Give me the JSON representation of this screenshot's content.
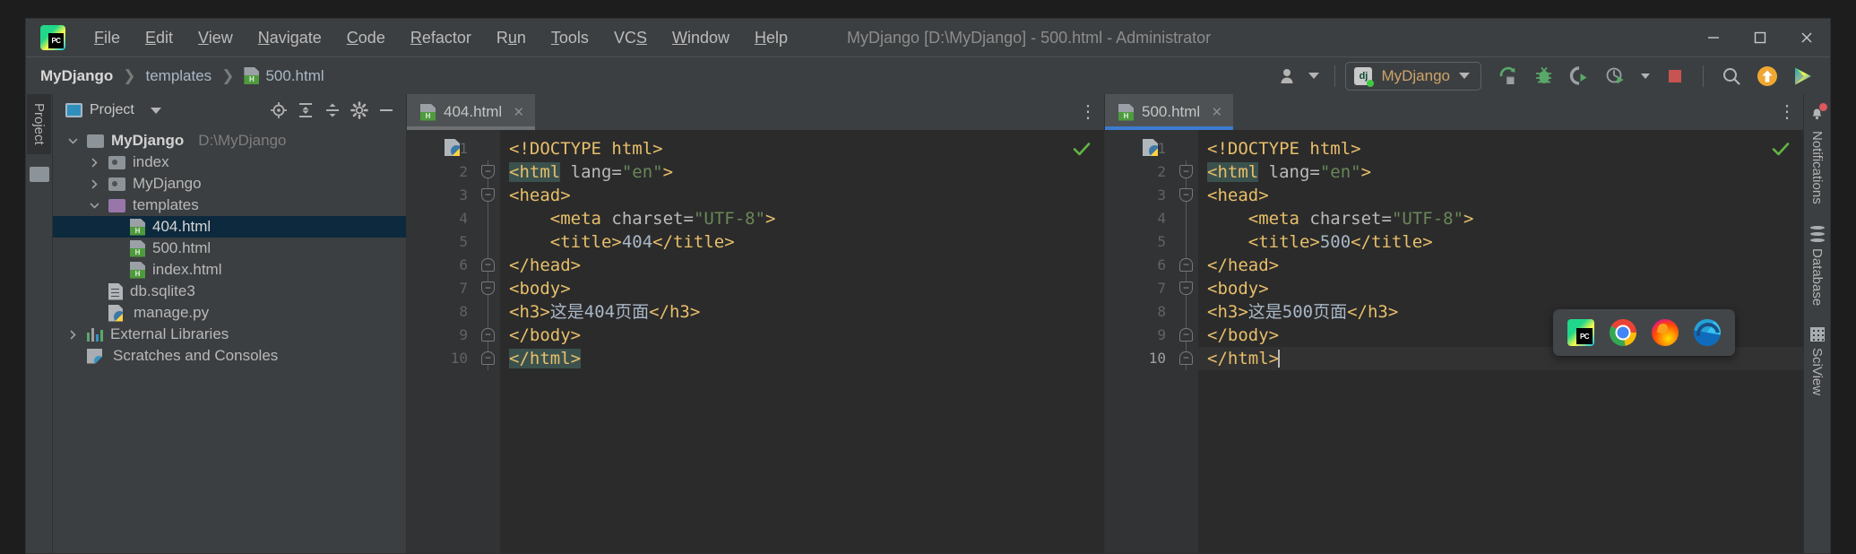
{
  "window": {
    "title": "MyDjango [D:\\MyDjango] - 500.html - Administrator",
    "app_icon": "pycharm-logo-icon",
    "minimize_label": "minimize-icon",
    "maximize_label": "maximize-icon",
    "close_label": "close-icon"
  },
  "menu": [
    {
      "label": "File",
      "mnemonic": "F"
    },
    {
      "label": "Edit",
      "mnemonic": "E"
    },
    {
      "label": "View",
      "mnemonic": "V"
    },
    {
      "label": "Navigate",
      "mnemonic": "N"
    },
    {
      "label": "Code",
      "mnemonic": "C"
    },
    {
      "label": "Refactor",
      "mnemonic": "R"
    },
    {
      "label": "Run",
      "mnemonic": "u"
    },
    {
      "label": "Tools",
      "mnemonic": "T"
    },
    {
      "label": "VCS",
      "mnemonic": "S"
    },
    {
      "label": "Window",
      "mnemonic": "W"
    },
    {
      "label": "Help",
      "mnemonic": "H"
    }
  ],
  "breadcrumb": [
    {
      "label": "MyDjango",
      "icon": ""
    },
    {
      "label": "templates",
      "icon": ""
    },
    {
      "label": "500.html",
      "icon": "html-file-icon"
    }
  ],
  "toolbar": {
    "user_icon": "user-account-icon",
    "run_config": {
      "name": "MyDjango",
      "icon": "django-icon"
    },
    "run_label": "run-icon",
    "debug_label": "debug-icon",
    "coverage_label": "coverage-icon",
    "profile_label": "profile-icon",
    "stop_label": "stop-icon",
    "search_label": "search-everywhere-icon",
    "update_label": "update-project-icon",
    "datalore_label": "datalore-icon"
  },
  "left_rail": {
    "tab": "Project"
  },
  "project_panel": {
    "title": "Project",
    "actions": [
      "locate-icon",
      "expand-all-icon",
      "collapse-all-icon",
      "settings-icon",
      "hide-icon"
    ],
    "tree": [
      {
        "label": "MyDjango",
        "sub": "D:\\MyDjango",
        "icon": "folder-root-icon",
        "depth": 0,
        "twisty": "expanded",
        "bold": true,
        "selected": false
      },
      {
        "label": "index",
        "sub": "",
        "icon": "folder-source-icon",
        "depth": 1,
        "twisty": "collapsed",
        "bold": false,
        "selected": false
      },
      {
        "label": "MyDjango",
        "sub": "",
        "icon": "folder-source-icon",
        "depth": 1,
        "twisty": "collapsed",
        "bold": false,
        "selected": false
      },
      {
        "label": "templates",
        "sub": "",
        "icon": "folder-templates-icon",
        "depth": 1,
        "twisty": "expanded",
        "bold": false,
        "selected": false
      },
      {
        "label": "404.html",
        "sub": "",
        "icon": "html-file-icon",
        "depth": 2,
        "twisty": "none",
        "bold": false,
        "selected": true
      },
      {
        "label": "500.html",
        "sub": "",
        "icon": "html-file-icon",
        "depth": 2,
        "twisty": "none",
        "bold": false,
        "selected": false
      },
      {
        "label": "index.html",
        "sub": "",
        "icon": "html-file-icon",
        "depth": 2,
        "twisty": "none",
        "bold": false,
        "selected": false
      },
      {
        "label": "db.sqlite3",
        "sub": "",
        "icon": "sqlite-file-icon",
        "depth": 1,
        "twisty": "none",
        "bold": false,
        "selected": false
      },
      {
        "label": "manage.py",
        "sub": "",
        "icon": "python-file-icon",
        "depth": 1,
        "twisty": "none",
        "bold": false,
        "selected": false
      },
      {
        "label": "External Libraries",
        "sub": "",
        "icon": "libraries-icon",
        "depth": 0,
        "twisty": "collapsed",
        "bold": false,
        "selected": false
      },
      {
        "label": "Scratches and Consoles",
        "sub": "",
        "icon": "scratches-icon",
        "depth": 0,
        "twisty": "none",
        "bold": false,
        "selected": false
      }
    ]
  },
  "editors": [
    {
      "tab": {
        "label": "404.html",
        "icon": "html-file-icon",
        "active": false,
        "close": "×"
      },
      "more_label": "⋮",
      "inspection_status": "✔",
      "lines": [
        {
          "no": "1",
          "fold": "none",
          "current": false,
          "segments": [
            {
              "t": "        ",
              "c": "txt"
            },
            {
              "t": "<!DOCTYPE html>",
              "c": "tag"
            }
          ]
        },
        {
          "no": "2",
          "fold": "down",
          "current": false,
          "segments": [
            {
              "t": "",
              "c": "txt"
            },
            {
              "t": "<html",
              "c": "tag hl"
            },
            {
              "t": " ",
              "c": "txt"
            },
            {
              "t": "lang=",
              "c": "attr"
            },
            {
              "t": "\"en\"",
              "c": "val"
            },
            {
              "t": ">",
              "c": "tag"
            }
          ]
        },
        {
          "no": "3",
          "fold": "down",
          "current": false,
          "segments": [
            {
              "t": "<head>",
              "c": "tag"
            }
          ]
        },
        {
          "no": "4",
          "fold": "none",
          "current": false,
          "segments": [
            {
              "t": "    ",
              "c": "txt"
            },
            {
              "t": "<meta",
              "c": "tag"
            },
            {
              "t": " ",
              "c": "txt"
            },
            {
              "t": "charset=",
              "c": "attr"
            },
            {
              "t": "\"UTF-8\"",
              "c": "val"
            },
            {
              "t": ">",
              "c": "tag"
            }
          ]
        },
        {
          "no": "5",
          "fold": "none",
          "current": false,
          "segments": [
            {
              "t": "    ",
              "c": "txt"
            },
            {
              "t": "<title>",
              "c": "tag"
            },
            {
              "t": "404",
              "c": "txt"
            },
            {
              "t": "</title>",
              "c": "tag"
            }
          ]
        },
        {
          "no": "6",
          "fold": "up",
          "current": false,
          "segments": [
            {
              "t": "</head>",
              "c": "tag"
            }
          ]
        },
        {
          "no": "7",
          "fold": "down",
          "current": false,
          "segments": [
            {
              "t": "<body>",
              "c": "tag"
            }
          ]
        },
        {
          "no": "8",
          "fold": "none",
          "current": false,
          "segments": [
            {
              "t": "<h3>",
              "c": "tag"
            },
            {
              "t": "这是404页面",
              "c": "txt"
            },
            {
              "t": "</h3>",
              "c": "tag"
            }
          ]
        },
        {
          "no": "9",
          "fold": "up",
          "current": false,
          "segments": [
            {
              "t": "</body>",
              "c": "tag"
            }
          ]
        },
        {
          "no": "10",
          "fold": "up",
          "current": false,
          "segments": [
            {
              "t": "</html>",
              "c": "tag hl"
            }
          ]
        }
      ]
    },
    {
      "tab": {
        "label": "500.html",
        "icon": "html-file-icon",
        "active": true,
        "close": "×"
      },
      "more_label": "⋮",
      "inspection_status": "✔",
      "lines": [
        {
          "no": "1",
          "fold": "none",
          "current": false,
          "segments": [
            {
              "t": "        ",
              "c": "txt"
            },
            {
              "t": "<!DOCTYPE html>",
              "c": "tag"
            }
          ]
        },
        {
          "no": "2",
          "fold": "down",
          "current": false,
          "segments": [
            {
              "t": "",
              "c": "txt"
            },
            {
              "t": "<html",
              "c": "tag hl"
            },
            {
              "t": " ",
              "c": "txt"
            },
            {
              "t": "lang=",
              "c": "attr"
            },
            {
              "t": "\"en\"",
              "c": "val"
            },
            {
              "t": ">",
              "c": "tag"
            }
          ]
        },
        {
          "no": "3",
          "fold": "down",
          "current": false,
          "segments": [
            {
              "t": "<head>",
              "c": "tag"
            }
          ]
        },
        {
          "no": "4",
          "fold": "none",
          "current": false,
          "segments": [
            {
              "t": "    ",
              "c": "txt"
            },
            {
              "t": "<meta",
              "c": "tag"
            },
            {
              "t": " ",
              "c": "txt"
            },
            {
              "t": "charset=",
              "c": "attr"
            },
            {
              "t": "\"UTF-8\"",
              "c": "val"
            },
            {
              "t": ">",
              "c": "tag"
            }
          ]
        },
        {
          "no": "5",
          "fold": "none",
          "current": false,
          "segments": [
            {
              "t": "    ",
              "c": "txt"
            },
            {
              "t": "<title>",
              "c": "tag"
            },
            {
              "t": "500",
              "c": "txt"
            },
            {
              "t": "</title>",
              "c": "tag"
            }
          ]
        },
        {
          "no": "6",
          "fold": "up",
          "current": false,
          "segments": [
            {
              "t": "</head>",
              "c": "tag"
            }
          ]
        },
        {
          "no": "7",
          "fold": "down",
          "current": false,
          "segments": [
            {
              "t": "<body>",
              "c": "tag"
            }
          ]
        },
        {
          "no": "8",
          "fold": "none",
          "current": false,
          "segments": [
            {
              "t": "<h3>",
              "c": "tag"
            },
            {
              "t": "这是500页面",
              "c": "txt"
            },
            {
              "t": "</h3>",
              "c": "tag"
            }
          ]
        },
        {
          "no": "9",
          "fold": "up",
          "current": false,
          "segments": [
            {
              "t": "</body>",
              "c": "tag"
            }
          ]
        },
        {
          "no": "10",
          "fold": "up",
          "current": true,
          "caret": true,
          "segments": [
            {
              "t": "</html>",
              "c": "tag"
            }
          ]
        }
      ]
    }
  ],
  "browser_popup": {
    "items": [
      {
        "name": "pycharm-preview-icon",
        "title": "PyCharm"
      },
      {
        "name": "chrome-icon",
        "title": "Chrome"
      },
      {
        "name": "firefox-icon",
        "title": "Firefox"
      },
      {
        "name": "edge-icon",
        "title": "Edge"
      }
    ]
  },
  "right_rail": [
    {
      "label": "Notifications",
      "icon": "bell-icon",
      "badge": true
    },
    {
      "label": "Database",
      "icon": "database-icon",
      "badge": false
    },
    {
      "label": "SciView",
      "icon": "sciview-icon",
      "badge": false
    }
  ],
  "colors": {
    "accent_blue": "#3d7bd0",
    "selection": "#0d293e",
    "tag": "#e8bf6a",
    "value": "#6a8759",
    "editor_bg": "#2b2b2b",
    "panel_bg": "#3c3f41",
    "ok_green": "#62b543",
    "stop_red": "#c75450"
  }
}
